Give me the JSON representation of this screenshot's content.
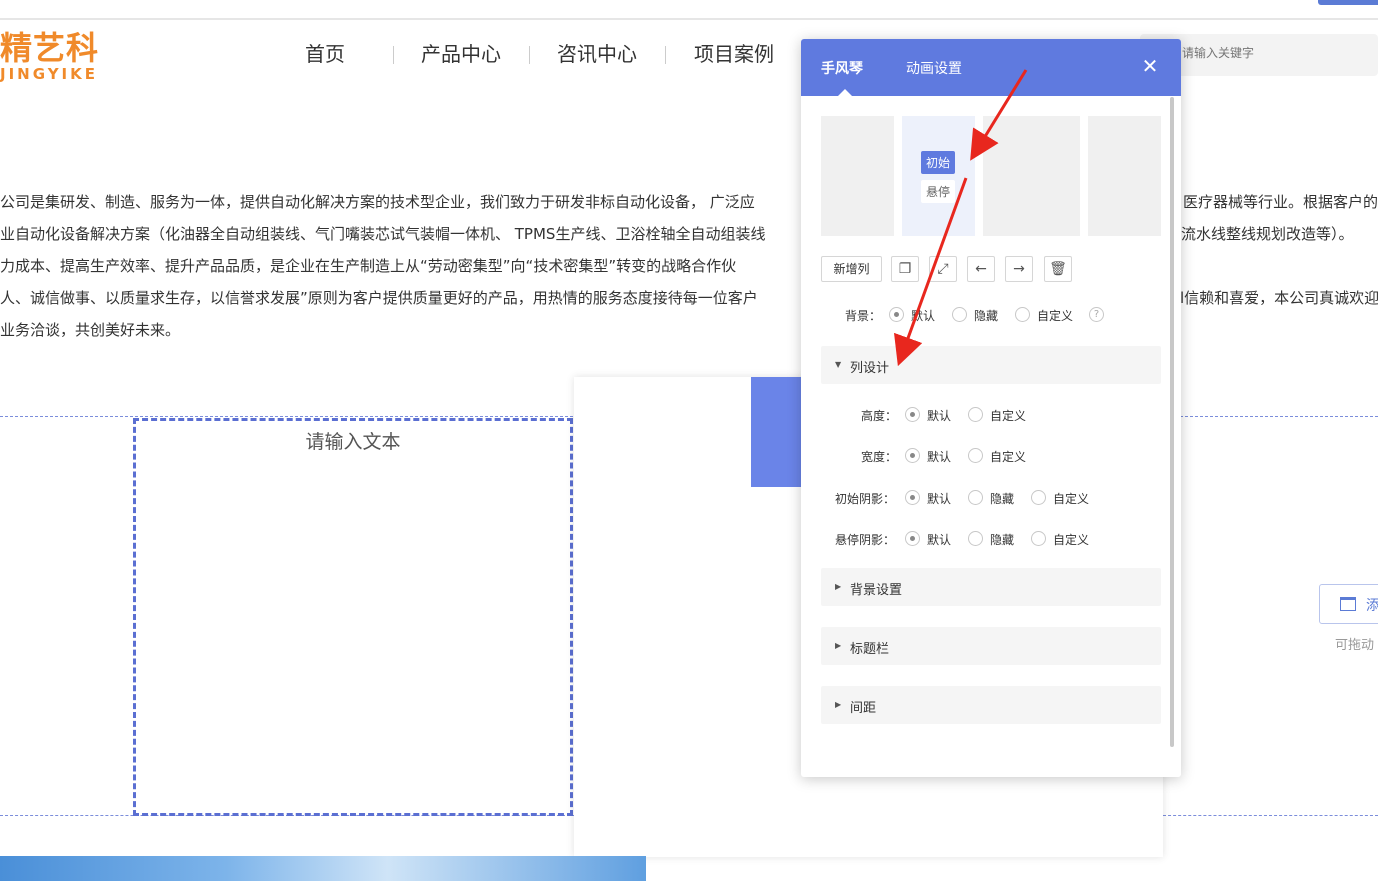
{
  "logo": {
    "main": "精艺科",
    "sub": "JINGYIKE"
  },
  "nav": [
    "首页",
    "产品中心",
    "咨讯中心",
    "项目案例"
  ],
  "search": {
    "placeholder": "请输入关键字"
  },
  "paragraph": {
    "line1_left": "公司是集研发、制造、服务为一体，提供自动化解决方案的技术型企业，我们致力于研发非标自动化设备， 广泛应",
    "line1_right": "医疗器械等行业。根据客户的",
    "line2_left": "业自动化设备解决方案（化油器全自动组装线、气门嘴装芯试气装帽一体机、 TPMS生产线、卫浴栓轴全自动组装线",
    "line2_right": "流水线整线规划改造等）。",
    "line3_left": "力成本、提高生产效率、提升产品品质，是企业在生产制造上从“劳动密集型”向“技术密集型”转变的战略合作伙",
    "line4_left": "人、诚信做事、以质量求生存，以信誉求发展”原则为客户提供质量更好的产品，用热情的服务态度接待每一位客户",
    "line4_right": "l信赖和喜爱，本公司真诚欢迎",
    "line5_left": "业务洽谈，共创美好未来。"
  },
  "textbox": {
    "placeholder": "请输入文本"
  },
  "add_button": {
    "label": "添"
  },
  "drag_hint": "可拖动",
  "panel": {
    "tabs": [
      "手风琴",
      "动画设置"
    ],
    "active_tab": 0,
    "close_icon": "close-icon",
    "states": {
      "initial": "初始",
      "hover": "悬停"
    },
    "toolbar": {
      "add_column": "新增列",
      "icons": [
        "copy-icon",
        "resize-icon",
        "arrow-left-icon",
        "arrow-right-icon",
        "trash-icon"
      ]
    },
    "background": {
      "label": "背景：",
      "options": [
        "默认",
        "隐藏",
        "自定义"
      ],
      "selected": 0,
      "help": "?"
    },
    "column_design": {
      "title": "列设计",
      "expanded": true,
      "rows": [
        {
          "label": "高度：",
          "options": [
            "默认",
            "自定义"
          ],
          "selected": 0
        },
        {
          "label": "宽度：",
          "options": [
            "默认",
            "自定义"
          ],
          "selected": 0
        },
        {
          "label": "初始阴影：",
          "options": [
            "默认",
            "隐藏",
            "自定义"
          ],
          "selected": 0
        },
        {
          "label": "悬停阴影：",
          "options": [
            "默认",
            "隐藏",
            "自定义"
          ],
          "selected": 0
        }
      ]
    },
    "sections": [
      "背景设置",
      "标题栏",
      "间距"
    ]
  },
  "colors": {
    "accent": "#5f7adf",
    "logo": "#f08a2a",
    "arrow": "#e8271e"
  }
}
